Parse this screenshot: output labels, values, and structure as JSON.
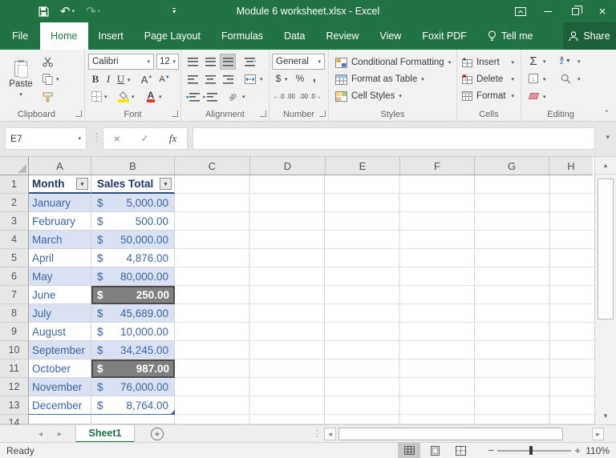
{
  "title_bar": {
    "title": "Module 6 worksheet.xlsx - Excel"
  },
  "tabs": {
    "file": "File",
    "home": "Home",
    "insert": "Insert",
    "page_layout": "Page Layout",
    "formulas": "Formulas",
    "data": "Data",
    "review": "Review",
    "view": "View",
    "foxit": "Foxit PDF",
    "tell_me": "Tell me",
    "share": "Share"
  },
  "ribbon": {
    "clipboard": {
      "label": "Clipboard",
      "paste": "Paste"
    },
    "font": {
      "label": "Font",
      "name": "Calibri",
      "size": "12",
      "bold": "B",
      "italic": "I",
      "underline": "U",
      "grow": "A",
      "shrink": "A",
      "color_a": "A"
    },
    "alignment": {
      "label": "Alignment"
    },
    "number": {
      "label": "Number",
      "format": "General",
      "dollar": "$",
      "percent": "%",
      "comma": ",",
      "inc_decimal": ".0 .00",
      "dec_decimal": ".00 .0"
    },
    "styles": {
      "label": "Styles",
      "conditional_formatting": "Conditional Formatting",
      "format_as_table": "Format as Table",
      "cell_styles": "Cell Styles"
    },
    "cells": {
      "label": "Cells",
      "insert": "Insert",
      "delete": "Delete",
      "format": "Format"
    },
    "editing": {
      "label": "Editing",
      "sum": "Σ",
      "sort_a": "A",
      "sort_z": "Z"
    }
  },
  "formula_bar": {
    "name_box": "E7",
    "cancel": "×",
    "enter": "✓",
    "fx": "fx",
    "formula": ""
  },
  "grid": {
    "columns": [
      "A",
      "B",
      "C",
      "D",
      "E",
      "F",
      "G",
      "H"
    ],
    "row_numbers": [
      "1",
      "2",
      "3",
      "4",
      "5",
      "6",
      "7",
      "8",
      "9",
      "10",
      "11",
      "12",
      "13",
      "14"
    ],
    "currency": "$",
    "table": {
      "headers": {
        "month": "Month",
        "sales": "Sales Total"
      },
      "rows": [
        {
          "month": "January",
          "amount": "5,000.00"
        },
        {
          "month": "February",
          "amount": "500.00"
        },
        {
          "month": "March",
          "amount": "50,000.00"
        },
        {
          "month": "April",
          "amount": "4,876.00"
        },
        {
          "month": "May",
          "amount": "80,000.00"
        },
        {
          "month": "June",
          "amount": "250.00"
        },
        {
          "month": "July",
          "amount": "45,689.00"
        },
        {
          "month": "August",
          "amount": "10,000.00"
        },
        {
          "month": "September",
          "amount": "34,245.00"
        },
        {
          "month": "October",
          "amount": "987.00"
        },
        {
          "month": "November",
          "amount": "76,000.00"
        },
        {
          "month": "December",
          "amount": "8,764.00"
        }
      ]
    }
  },
  "sheet_bar": {
    "sheet_name": "Sheet1",
    "add_sheet": "+"
  },
  "status_bar": {
    "status": "Ready",
    "zoom_level": "110%",
    "zoom_minus": "−",
    "zoom_plus": "+"
  },
  "icons": {
    "undo": "↶",
    "redo": "↷",
    "dropdown": "▾",
    "close": "×",
    "up_arrow": "▲",
    "down_arrow": "▼",
    "left_small": "◂",
    "right_small": "▸",
    "ellipsis": "⋮",
    "fill_down": "↓",
    "sort_down": "▼"
  },
  "colors": {
    "excel_green": "#217346",
    "band_blue": "#d9e1f2",
    "header_navy": "#1f3864",
    "data_blue": "#3d64ad",
    "highlight_gray": "#808080"
  }
}
